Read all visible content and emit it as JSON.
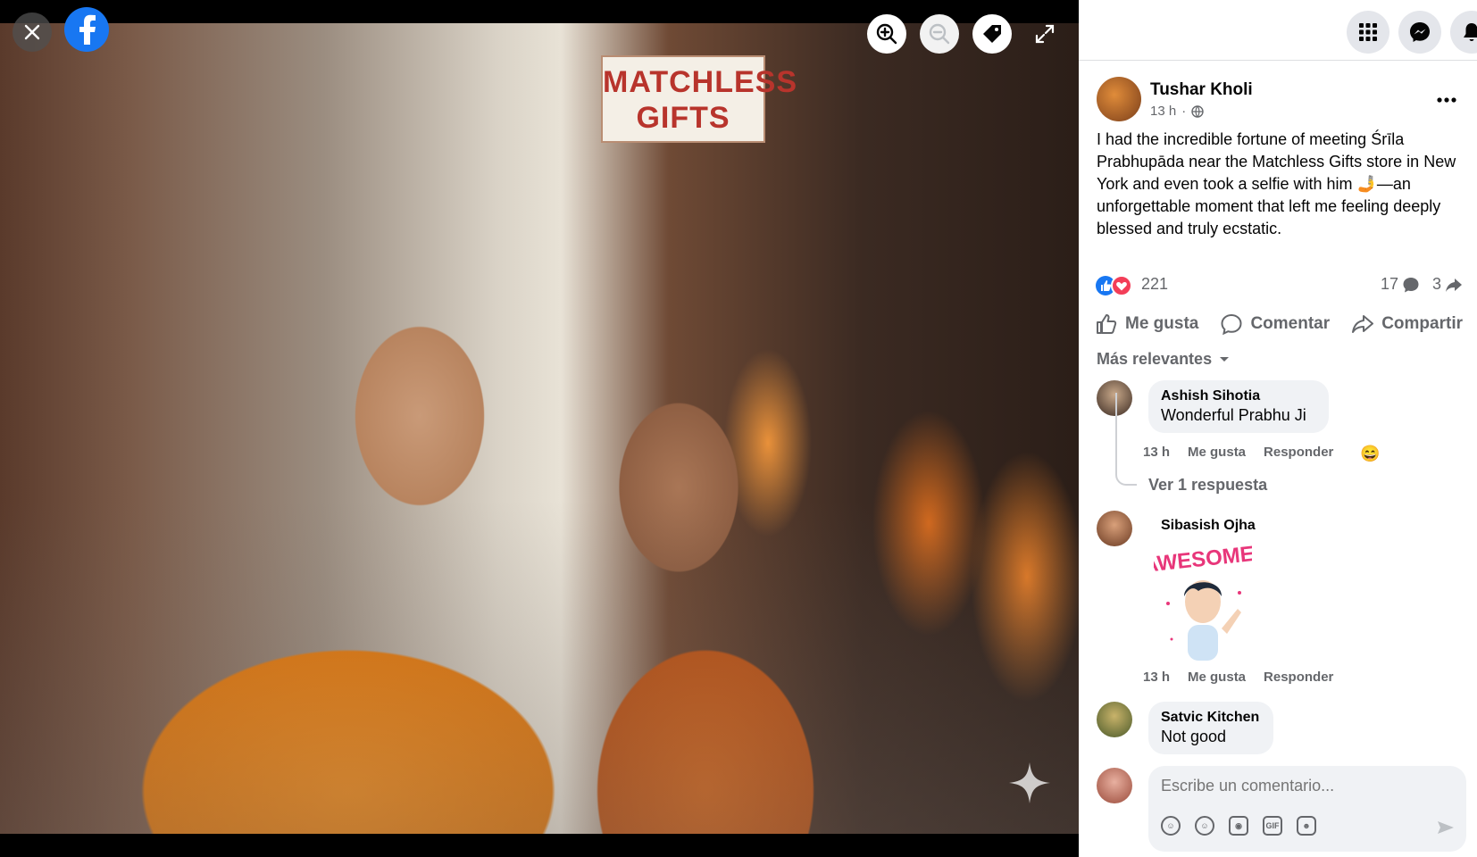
{
  "viewer": {
    "sign_line1": "MATCHLESS",
    "sign_line2": "GIFTS",
    "controls": [
      "close-icon",
      "facebook-logo",
      "zoom-in-icon",
      "zoom-out-icon",
      "tag-icon",
      "fullscreen-icon"
    ]
  },
  "header_icons": [
    "apps-grid-icon",
    "messenger-icon",
    "notifications-icon"
  ],
  "post": {
    "author": "Tushar Kholi",
    "time": "13 h",
    "audience_icon": "globe-icon",
    "text": "I had the incredible fortune of meeting Śrīla Prabhupāda near the Matchless Gifts store in New York and even took a selfie with him 🤳—an unforgettable moment that left me feeling deeply blessed and truly ecstatic.",
    "reactions_count": "221",
    "comments_count": "17",
    "shares_count": "3"
  },
  "actions": {
    "like": "Me gusta",
    "comment": "Comentar",
    "share": "Compartir"
  },
  "sort_label": "Más relevantes",
  "comments": [
    {
      "name": "Ashish Sihotia",
      "text": "Wonderful Prabhu Ji",
      "time": "13 h",
      "like": "Me gusta",
      "reply": "Responder",
      "reaction": "😄",
      "replies_link": "Ver 1 respuesta"
    },
    {
      "name": "Sibasish Ojha",
      "sticker_text": "AWESOME!",
      "time": "13 h",
      "like": "Me gusta",
      "reply": "Responder"
    },
    {
      "name": "Satvic Kitchen",
      "text": "Not good"
    }
  ],
  "composer": {
    "placeholder": "Escribe un comentario...",
    "tools": [
      "avatar-sticker-icon",
      "emoji-icon",
      "camera-icon",
      "gif-icon",
      "sticker-icon"
    ]
  },
  "colors": {
    "facebook_blue": "#1877f2",
    "text_secondary": "#65676b",
    "bubble_bg": "#f0f2f5"
  }
}
